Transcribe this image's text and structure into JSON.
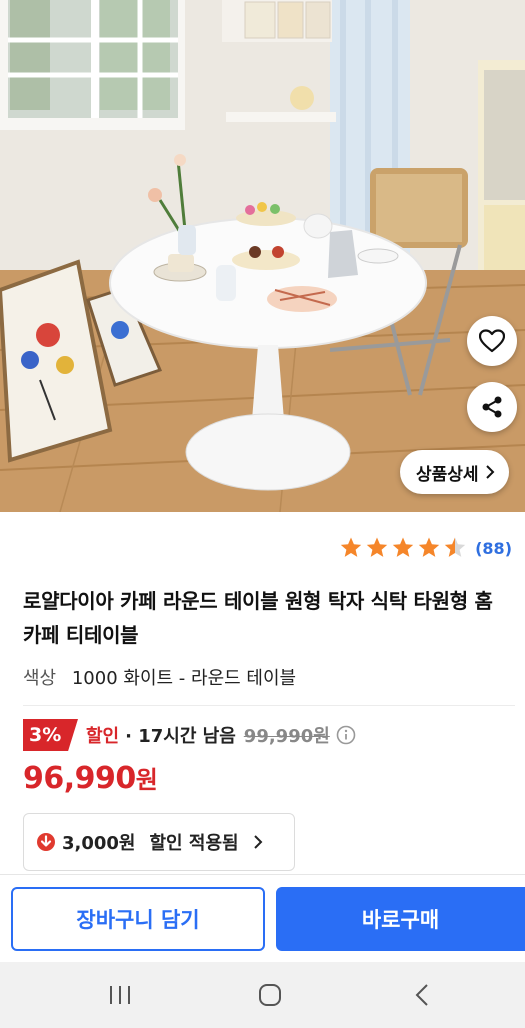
{
  "product_image": {
    "alt": "",
    "detail_button_label": "상품상세"
  },
  "rating": {
    "stars": 4.5,
    "count_label": "(88)"
  },
  "product": {
    "title": "로얄다이아 카페 라운드 테이블 원형 탁자 식탁 타원형 홈카페 티테이블",
    "option_label": "색상",
    "option_value": "1000 화이트 - 라운드 테이블"
  },
  "discount": {
    "percent_label": "3%",
    "word": "할인",
    "time_left": "· 17시간 남음",
    "original_price": "99,990원"
  },
  "price": {
    "amount": "96,990",
    "unit": "원"
  },
  "coupon": {
    "amount": "3,000원",
    "text": "할인 적용됨"
  },
  "actions": {
    "cart_label": "장바구니 담기",
    "buy_label": "바로구매"
  },
  "colors": {
    "accent_blue": "#2a6ef5",
    "discount_red": "#d8262a",
    "star_orange": "#f5862a"
  },
  "icons": {
    "heart": "heart-icon",
    "share": "share-icon",
    "chevron": "chevron-right-icon",
    "info": "info-icon",
    "down_arrow": "arrow-down-circle-icon",
    "nav_recent": "recent-apps-icon",
    "nav_home": "home-icon",
    "nav_back": "back-icon"
  }
}
